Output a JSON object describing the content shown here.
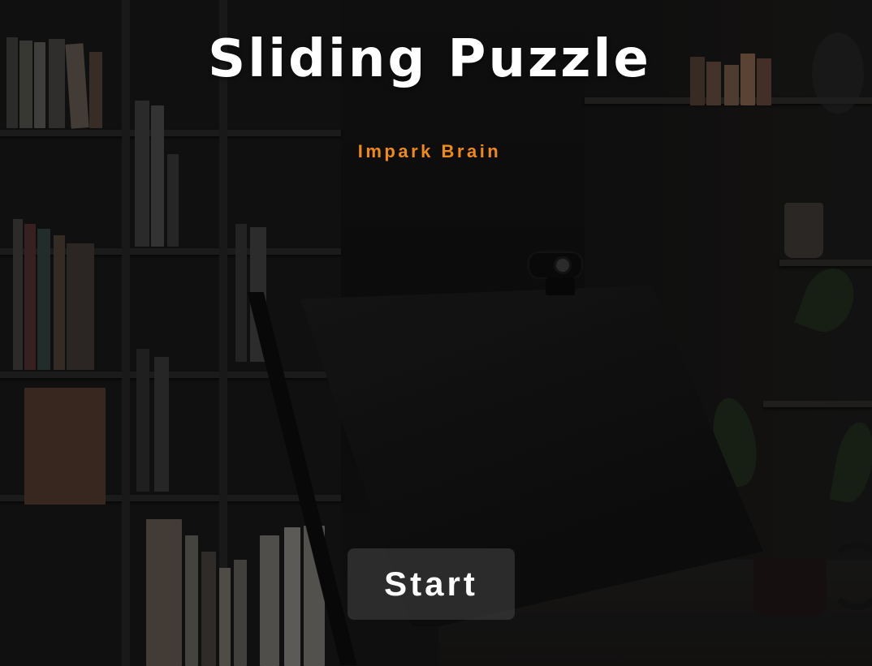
{
  "game": {
    "title": "Sliding Puzzle",
    "subtitle": "Impark Brain",
    "start_label": "Start"
  },
  "colors": {
    "title": "#ffffff",
    "subtitle": "#ef8a17",
    "button_bg": "rgba(70,70,70,0.55)",
    "button_text": "#ffffff"
  },
  "background": {
    "icon": "dark-office-bookshelf-photo"
  }
}
